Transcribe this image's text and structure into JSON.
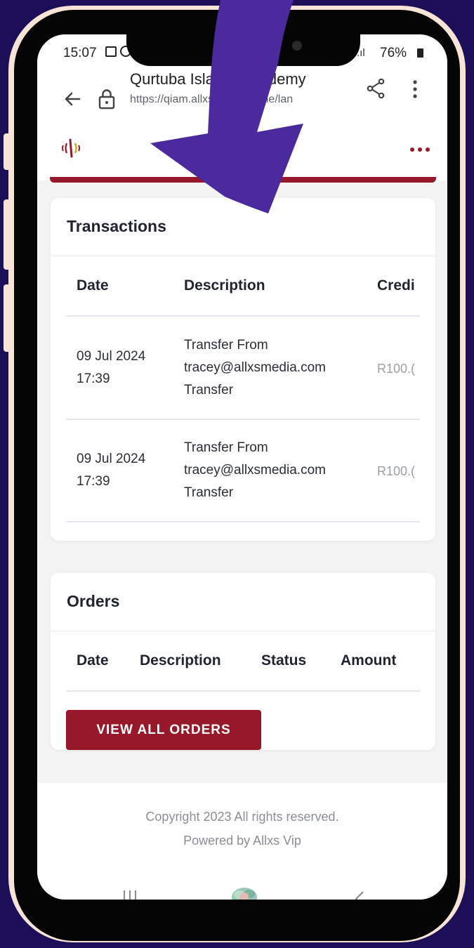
{
  "status_bar": {
    "time": "15:07",
    "signal": ".ıl",
    "battery": "76%"
  },
  "browser": {
    "site_title": "Qurtuba Islamic Academy",
    "url": "https://qiam.allxs.co.za/home/lan"
  },
  "icons": {
    "back": "back-arrow-icon",
    "lock": "lock-icon",
    "share": "share-icon",
    "menu": "kebab-menu-icon",
    "logo": "allxs-logo-icon",
    "more": "more-dots-icon"
  },
  "transactions": {
    "title": "Transactions",
    "headers": [
      "Date",
      "Description",
      "Credi"
    ],
    "rows": [
      {
        "date_line1": "09 Jul 2024",
        "date_line2": "17:39",
        "desc_line1": "Transfer From",
        "desc_line2": "tracey@allxsmedia.com",
        "desc_line3": "Transfer",
        "credit": "R100.("
      },
      {
        "date_line1": "09 Jul 2024",
        "date_line2": "17:39",
        "desc_line1": "Transfer From",
        "desc_line2": "tracey@allxsmedia.com",
        "desc_line3": "Transfer",
        "credit": "R100.("
      }
    ]
  },
  "orders": {
    "title": "Orders",
    "headers": [
      "Date",
      "Description",
      "Status",
      "Amount"
    ],
    "view_all": "VIEW ALL ORDERS"
  },
  "footer": {
    "copyright": "Copyright 2023 All rights reserved.",
    "powered": "Powered by Allxs Vip"
  },
  "colors": {
    "brand": "#96182a",
    "background": "#1c0f57",
    "frame": "#f7e4d6",
    "arrow": "#4a2a9c"
  }
}
